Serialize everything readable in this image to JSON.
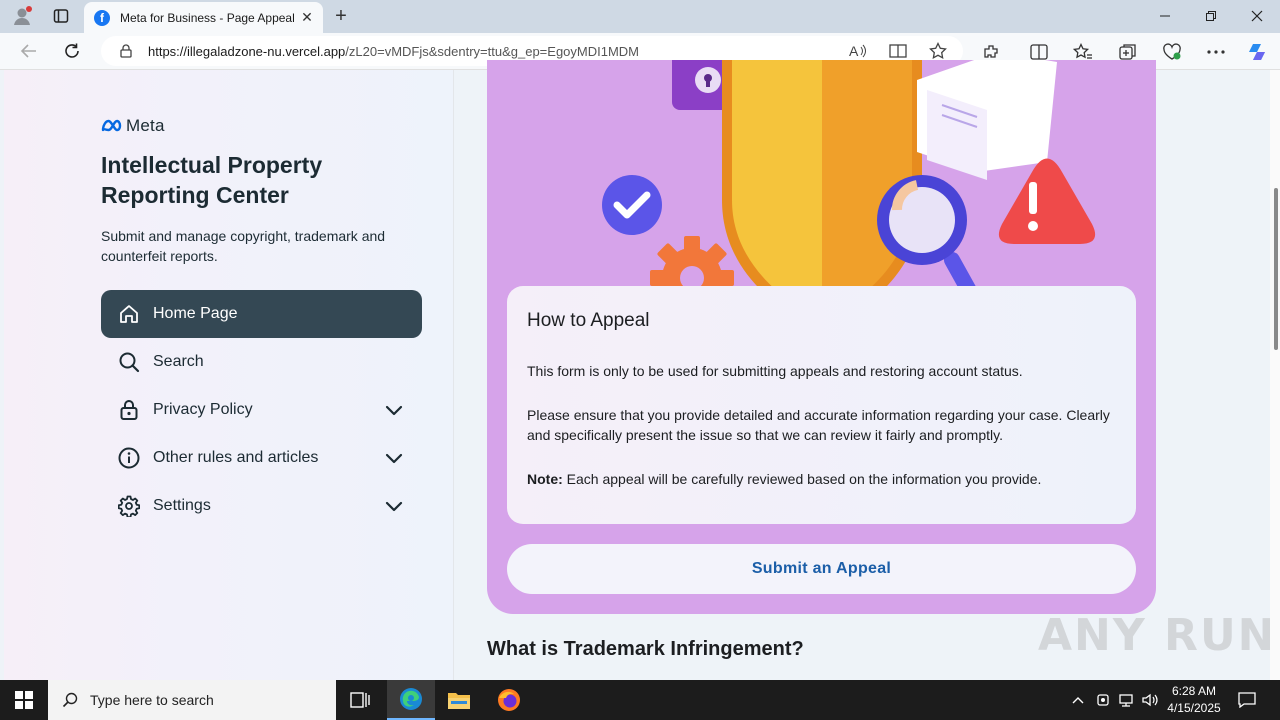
{
  "browser": {
    "tab_title": "Meta for Business - Page Appeal",
    "tab_favicon": "f",
    "url_host": "https://illegaladzone-nu.vercel.app",
    "url_path": "/zL20=vMDFjs&sdentry=ttu&g_ep=EgoyMDI1MDM"
  },
  "sidebar": {
    "logo_text": "Meta",
    "title": "Intellectual Property Reporting Center",
    "description": "Submit and manage copyright, trademark and counterfeit reports.",
    "nav": [
      {
        "label": "Home Page",
        "icon": "home-icon",
        "active": true
      },
      {
        "label": "Search",
        "icon": "search-icon"
      },
      {
        "label": "Privacy Policy",
        "icon": "lock-icon",
        "expandable": true
      },
      {
        "label": "Other rules and articles",
        "icon": "info-icon",
        "expandable": true
      },
      {
        "label": "Settings",
        "icon": "gear-icon",
        "expandable": true
      }
    ]
  },
  "main": {
    "card": {
      "heading": "How to Appeal",
      "p1": "This form is only to be used for submitting appeals and restoring account status.",
      "p2": "Please ensure that you provide detailed and accurate information regarding your case. Clearly and specifically present the issue so that we can review it fairly and promptly.",
      "note_label": "Note:",
      "note_text": " Each appeal will be carefully reviewed based on the information you provide."
    },
    "appeal_button": "Submit an Appeal",
    "section_heading": "What is Trademark Infringement?"
  },
  "watermark": "ANY RUN",
  "taskbar": {
    "search_placeholder": "Type here to search",
    "time": "6:28 AM",
    "date": "4/15/2025"
  },
  "colors": {
    "hero_bg": "#d6a3ea",
    "active_nav": "#344854",
    "appeal_text": "#1b5ea8"
  }
}
